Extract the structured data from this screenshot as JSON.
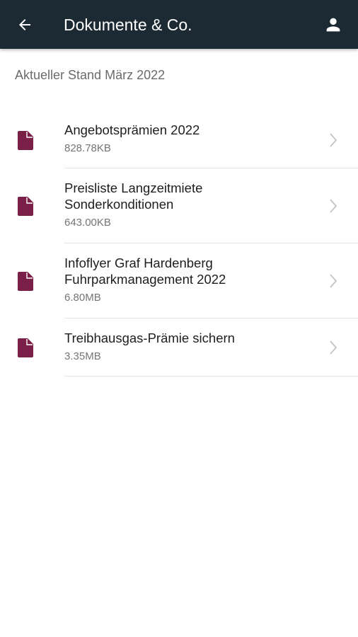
{
  "appbar": {
    "title": "Dokumente & Co.",
    "back_icon": "arrow-left-icon",
    "profile_icon": "person-icon",
    "background": "#1c2b33"
  },
  "subtitle": "Aktueller Stand März 2022",
  "accent_color": "#7a1f47",
  "documents": [
    {
      "title_lines": [
        "Angebotsprämien 2022"
      ],
      "size": "828.78KB"
    },
    {
      "title_lines": [
        "Preisliste Langzeitmiete",
        "Sonderkonditionen"
      ],
      "size": "643.00KB"
    },
    {
      "title_lines": [
        "Infoflyer Graf Hardenberg",
        "Fuhrparkmanagement 2022"
      ],
      "size": "6.80MB"
    },
    {
      "title_lines": [
        "Treibhausgas-Prämie sichern"
      ],
      "size": "3.35MB"
    }
  ]
}
